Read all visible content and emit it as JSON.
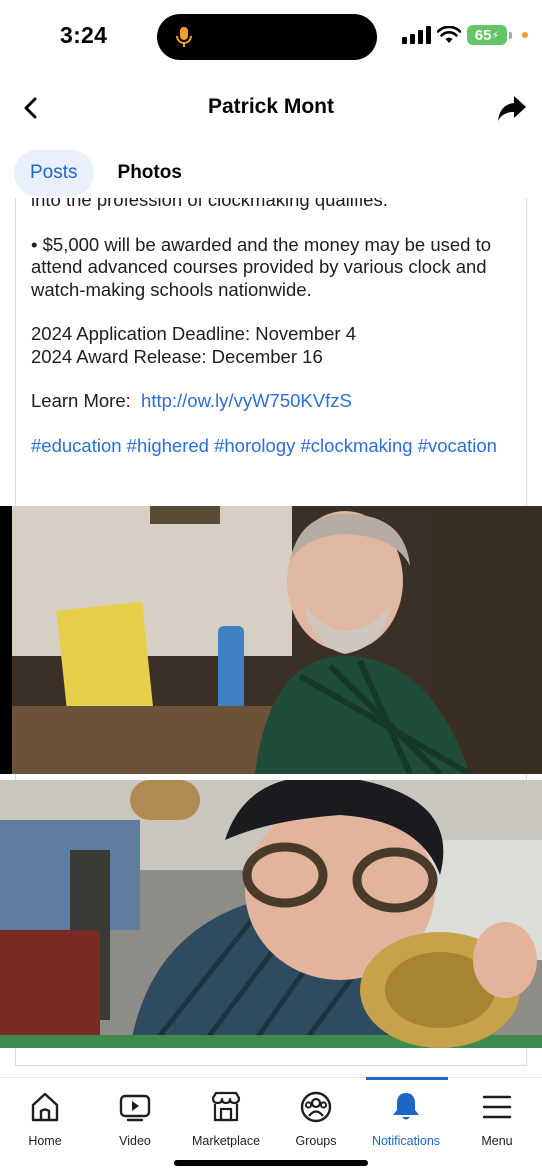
{
  "status": {
    "time": "3:24",
    "battery": "65"
  },
  "header": {
    "title": "Patrick Mont"
  },
  "tabs": [
    {
      "label": "Posts",
      "active": true
    },
    {
      "label": "Photos",
      "active": false
    }
  ],
  "post": {
    "partial_line": "into the profession of clockmaking qualifies.",
    "award_line": "• $5,000 will be awarded and the money may be used to attend advanced courses provided by various clock and watch-making schools nationwide.",
    "deadline_line": "2024 Application Deadline:  November 4",
    "release_line": "2024 Award Release:  December 16",
    "learn_more_label": "Learn More:",
    "learn_more_link": "http://ow.ly/vyW750KVfzS",
    "hashtags": [
      "#education",
      "#highered",
      "#horology",
      "#clockmaking",
      "#vocation"
    ]
  },
  "bottom_nav": [
    {
      "label": "Home",
      "icon": "home-icon"
    },
    {
      "label": "Video",
      "icon": "video-icon"
    },
    {
      "label": "Marketplace",
      "icon": "marketplace-icon"
    },
    {
      "label": "Groups",
      "icon": "groups-icon"
    },
    {
      "label": "Notifications",
      "icon": "bell-icon",
      "active": true
    },
    {
      "label": "Menu",
      "icon": "menu-icon"
    }
  ],
  "colors": {
    "accent": "#1b66c9",
    "link": "#2a6fd6",
    "battery": "#65c466"
  }
}
